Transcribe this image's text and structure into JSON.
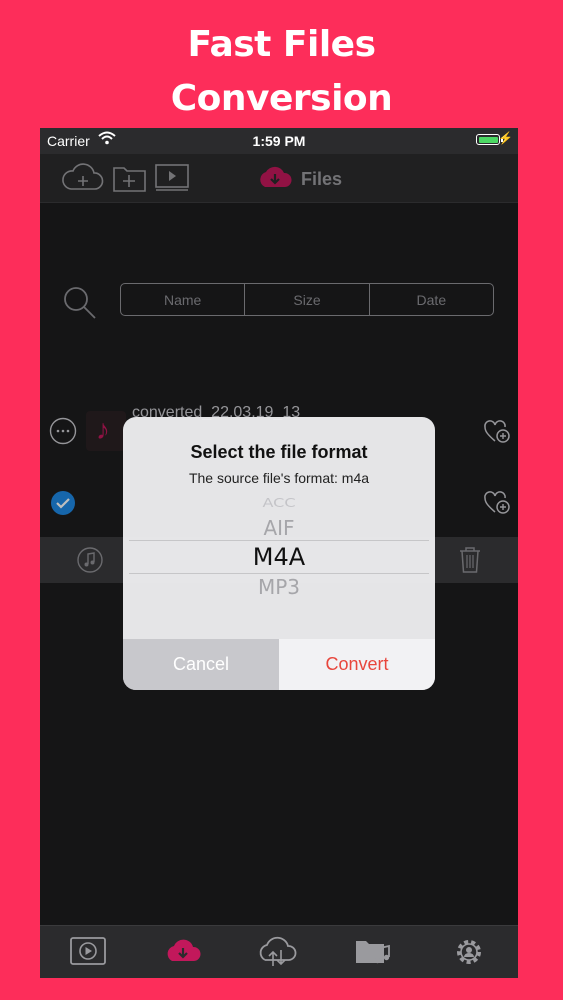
{
  "promo": {
    "line1": "Fast Files",
    "line2": "Conversion"
  },
  "status_bar": {
    "carrier": "Carrier",
    "time": "1:59 PM"
  },
  "nav": {
    "title": "Files"
  },
  "sort": {
    "name": "Name",
    "size": "Size",
    "date": "Date"
  },
  "file_row": {
    "name": "converted_22.03.19_13"
  },
  "dialog": {
    "title": "Select the file format",
    "subtitle": "The source file's format: m4a",
    "formats": [
      "ACC",
      "AIF",
      "M4A",
      "MP3"
    ],
    "selected": "M4A",
    "cancel_label": "Cancel",
    "convert_label": "Convert"
  },
  "colors": {
    "background": "#fd2d5a",
    "accent": "#c2185b",
    "convert": "#e8463c"
  },
  "tabbar": {
    "tabs": [
      "video-icon",
      "cloud-download-icon",
      "cloud-sync-icon",
      "music-folder-icon",
      "settings-icon"
    ]
  }
}
